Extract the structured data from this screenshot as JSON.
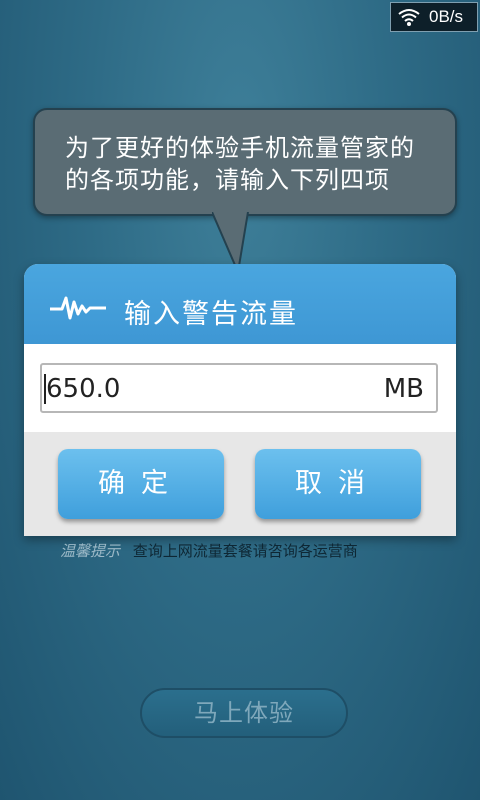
{
  "status_bar": {
    "network_speed": "0B/s",
    "wifi_icon": "wifi-icon"
  },
  "bubble": {
    "line1": "为了更好的体验手机流量管家的",
    "line2": "的各项功能，请输入下列四项"
  },
  "dialog": {
    "title": "输入警告流量",
    "icon": "pulse-wave-icon",
    "input_value": "650.0",
    "unit": "MB",
    "ok_label": "确定",
    "cancel_label": "取消"
  },
  "tip": {
    "label": "温馨提示",
    "text": "查询上网流量套餐请咨询各运营商"
  },
  "experience_button": "马上体验",
  "colors": {
    "background": "#2e6b86",
    "dialog_header": "#3e97d4",
    "button_blue": "#4aa6df",
    "bubble": "#5a6c74"
  }
}
